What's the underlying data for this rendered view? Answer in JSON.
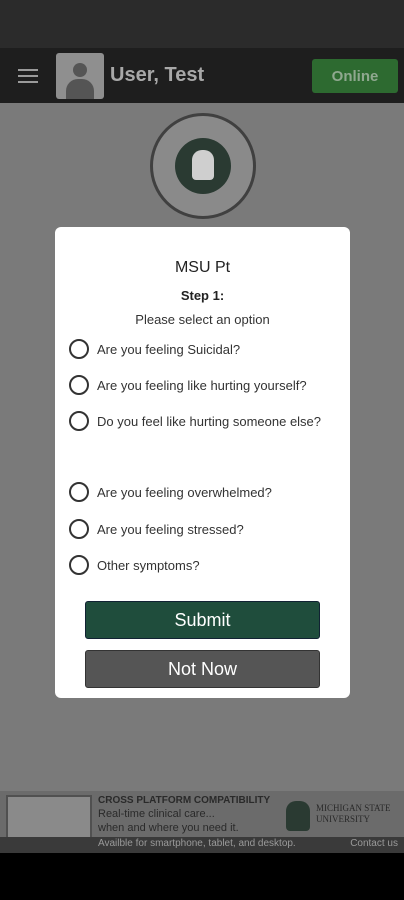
{
  "app_bar": {
    "user_name": "User, Test",
    "online_label": "Online"
  },
  "modal": {
    "title": "MSU Pt",
    "step": "Step 1:",
    "prompt": "Please select an option",
    "options": [
      "Are you feeling Suicidal?",
      "Are you feeling like hurting yourself?",
      "Do you feel like hurting someone else?",
      "Are you feeling overwhelmed?",
      "Are you feeling stressed?",
      "Other symptoms?"
    ],
    "submit_label": "Submit",
    "not_now_label": "Not Now"
  },
  "banner": {
    "title": "CROSS PLATFORM COMPATIBILITY",
    "line1": "Real-time clinical care...",
    "line2": "when and where you need it.",
    "availability": "Availble for smartphone, tablet, and desktop.",
    "contact": "Contact us",
    "university": "MICHIGAN STATE UNIVERSITY"
  },
  "colors": {
    "primary_green": "#1f4d3c",
    "online_green": "#2d6a30",
    "neutral_button": "#555555"
  }
}
